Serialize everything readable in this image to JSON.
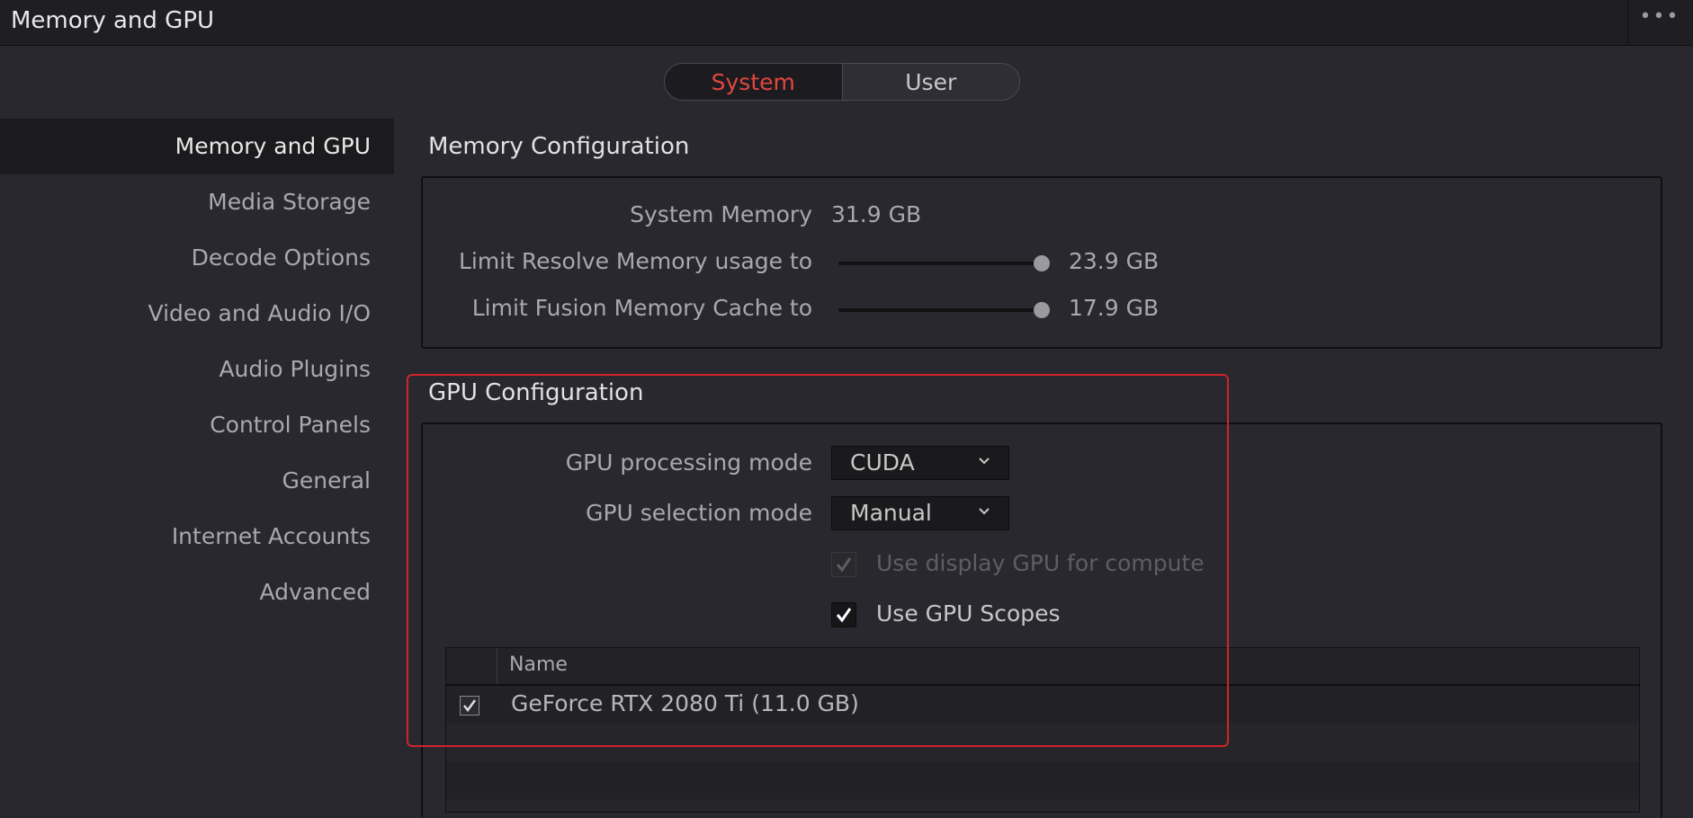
{
  "window": {
    "title": "Memory and GPU",
    "more_icon": "more-horizontal-icon"
  },
  "tabs": [
    {
      "label": "System",
      "selected": true
    },
    {
      "label": "User",
      "selected": false
    }
  ],
  "colors": {
    "accent": "#e2463e",
    "highlight_border": "#d0242b",
    "background": "#28282e"
  },
  "sidebar": {
    "items": [
      {
        "label": "Memory and GPU",
        "active": true
      },
      {
        "label": "Media Storage"
      },
      {
        "label": "Decode Options"
      },
      {
        "label": "Video and Audio I/O"
      },
      {
        "label": "Audio Plugins"
      },
      {
        "label": "Control Panels"
      },
      {
        "label": "General"
      },
      {
        "label": "Internet Accounts"
      },
      {
        "label": "Advanced"
      }
    ]
  },
  "memory": {
    "title": "Memory Configuration",
    "system_memory_label": "System Memory",
    "system_memory_value": "31.9 GB",
    "resolve_limit_label": "Limit Resolve Memory usage to",
    "resolve_limit_value": "23.9 GB",
    "resolve_limit_fraction": 1.0,
    "fusion_cache_label": "Limit Fusion Memory Cache to",
    "fusion_cache_value": "17.9 GB",
    "fusion_cache_fraction": 1.0
  },
  "gpu": {
    "title": "GPU Configuration",
    "processing_mode_label": "GPU processing mode",
    "processing_mode_value": "CUDA",
    "selection_mode_label": "GPU selection mode",
    "selection_mode_value": "Manual",
    "display_gpu_label": "Use display GPU for compute",
    "display_gpu_checked": true,
    "display_gpu_disabled": true,
    "scopes_label": "Use GPU Scopes",
    "scopes_checked": true,
    "table": {
      "column_name": "Name",
      "rows": [
        {
          "name": "GeForce RTX 2080 Ti (11.0 GB)",
          "checked": true
        }
      ]
    }
  }
}
